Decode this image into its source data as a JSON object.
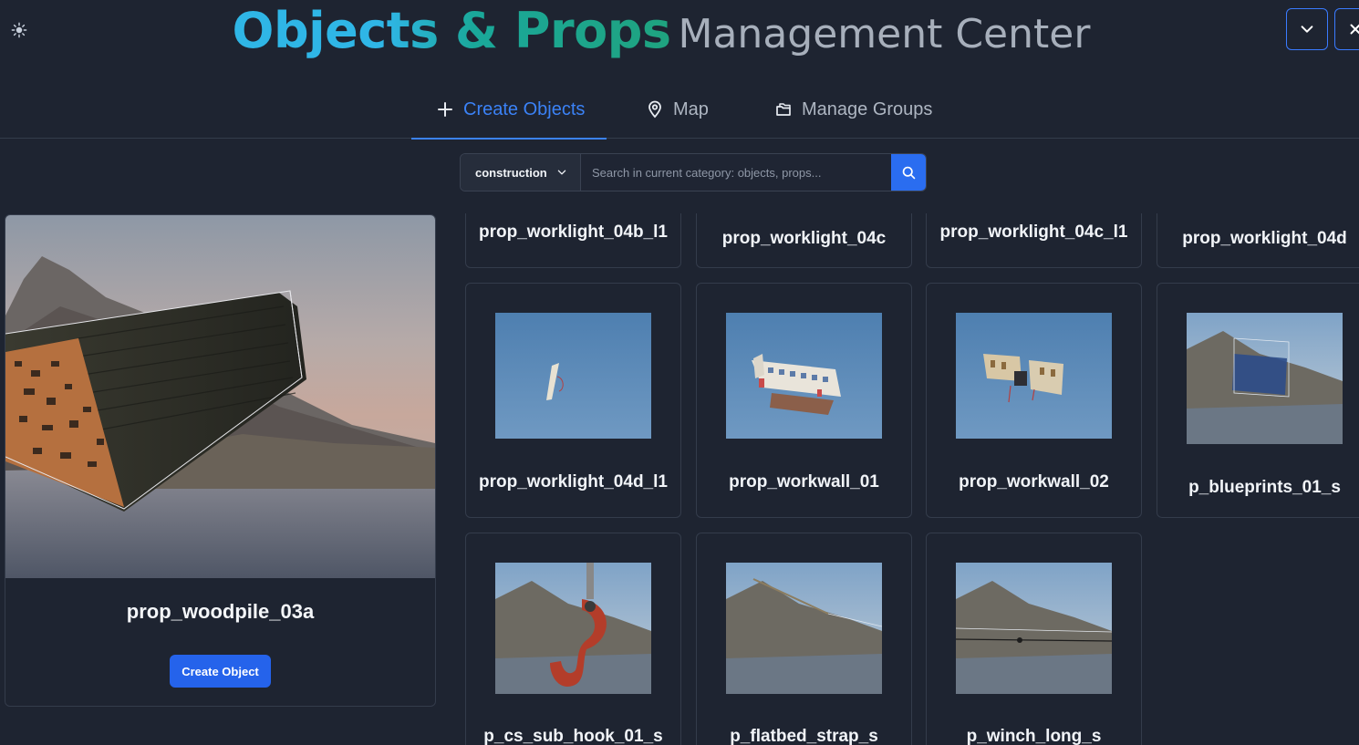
{
  "header": {
    "title_brand": "Objects & Props",
    "title_sub": "Management Center",
    "theme_icon": "sun-icon",
    "collapse_icon": "chevron-down-icon",
    "close_icon": "close-icon"
  },
  "tabs": [
    {
      "label": "Create Objects",
      "icon": "plus-icon",
      "active": true
    },
    {
      "label": "Map",
      "icon": "map-pin-icon",
      "active": false
    },
    {
      "label": "Manage Groups",
      "icon": "folders-icon",
      "active": false
    }
  ],
  "search": {
    "category": "construction",
    "placeholder": "Search in current category: objects, props...",
    "value": ""
  },
  "preview": {
    "name": "prop_woodpile_03a",
    "button_label": "Create Object"
  },
  "objects": [
    {
      "name": "prop_worklight_04b_l1"
    },
    {
      "name": "prop_worklight_04c"
    },
    {
      "name": "prop_worklight_04c_l1"
    },
    {
      "name": "prop_worklight_04d"
    },
    {
      "name": "prop_worklight_04d_l1"
    },
    {
      "name": "prop_workwall_01"
    },
    {
      "name": "prop_workwall_02"
    },
    {
      "name": "p_blueprints_01_s"
    },
    {
      "name": "p_cs_sub_hook_01_s"
    },
    {
      "name": "p_flatbed_strap_s"
    },
    {
      "name": "p_winch_long_s"
    }
  ],
  "colors": {
    "accent": "#3b82f6",
    "background": "#1e2431",
    "button": "#2563eb"
  }
}
